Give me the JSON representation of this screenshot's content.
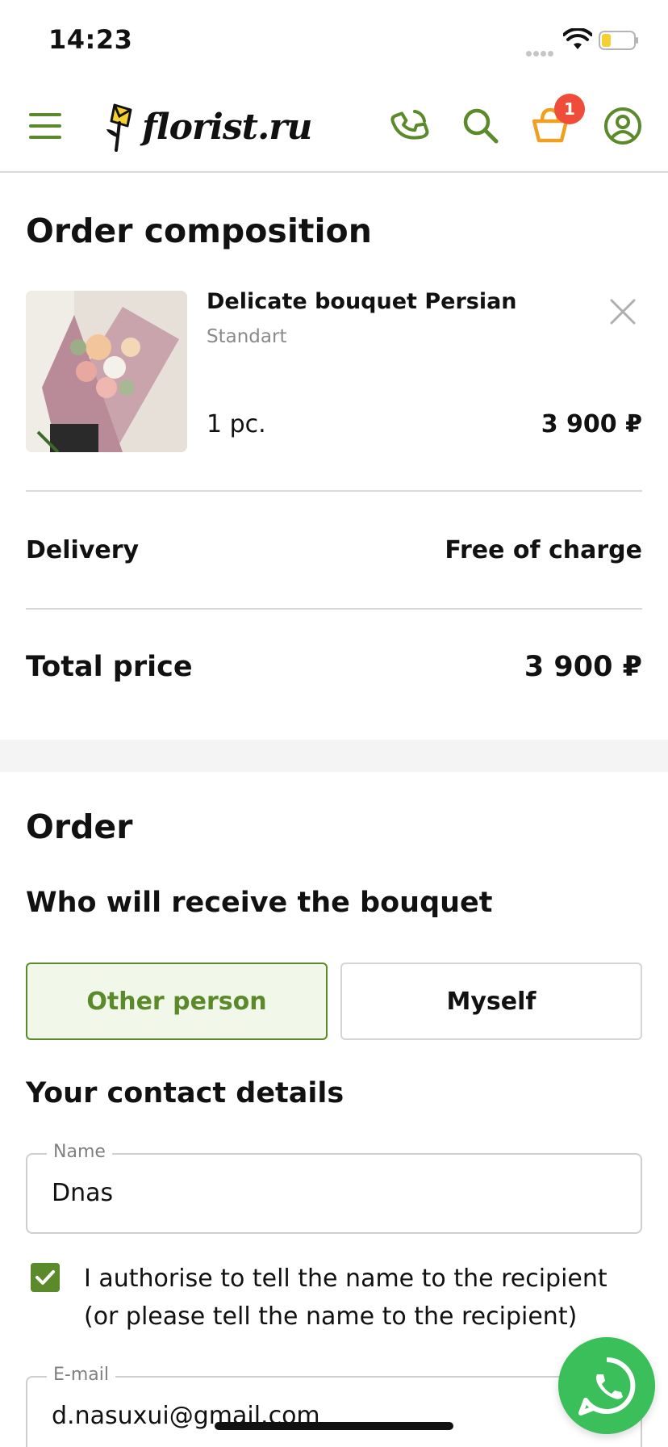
{
  "status_bar": {
    "time": "14:23"
  },
  "header": {
    "logo_text": "florist.ru",
    "cart_count": "1",
    "icons": [
      "menu-icon",
      "phone-icon",
      "search-icon",
      "cart-icon",
      "account-icon"
    ]
  },
  "order_composition": {
    "title": "Order composition",
    "item": {
      "name": "Delicate bouquet Persian",
      "variant": "Standart",
      "quantity": "1 pc.",
      "price": "3 900 ₽"
    },
    "delivery_label": "Delivery",
    "delivery_value": "Free of charge",
    "total_label": "Total price",
    "total_value": "3 900 ₽"
  },
  "order": {
    "title": "Order",
    "receiver_title": "Who will receive the bouquet",
    "receiver_options": [
      "Other person",
      "Myself"
    ],
    "selected_receiver": "Other person",
    "contact_title": "Your contact details",
    "name_label": "Name",
    "name_value": "Dnas",
    "authorise_checked": true,
    "authorise_text": "I authorise to tell the name to the recipient (or please tell the name to the recipient)",
    "email_label": "E-mail",
    "email_value": "d.nasuxui@gmail.com"
  },
  "colors": {
    "brand_green": "#5b8a2b",
    "cart_orange": "#f0a020",
    "badge_red": "#ef4c3a",
    "whatsapp_green": "#3bbf5b"
  }
}
